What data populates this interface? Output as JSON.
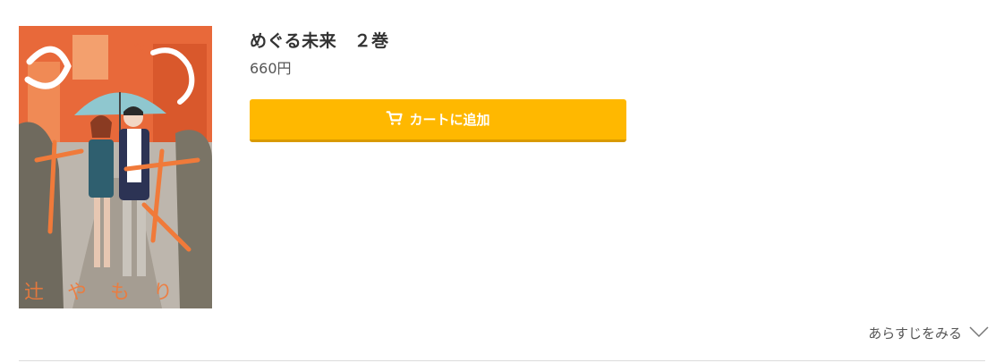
{
  "product": {
    "title": "めぐる未来　２巻",
    "price": "660円",
    "cover": {
      "volume_number": "2",
      "series_title_art": "めぐる未来",
      "author_art": "辻やもり"
    }
  },
  "actions": {
    "add_to_cart_label": "カートに追加",
    "cart_icon": "cart-icon"
  },
  "synopsis": {
    "toggle_label": "あらすじをみる",
    "toggle_icon": "chevron-down-icon"
  },
  "colors": {
    "button": "#ffb800",
    "cover_accent": "#e8693a"
  }
}
